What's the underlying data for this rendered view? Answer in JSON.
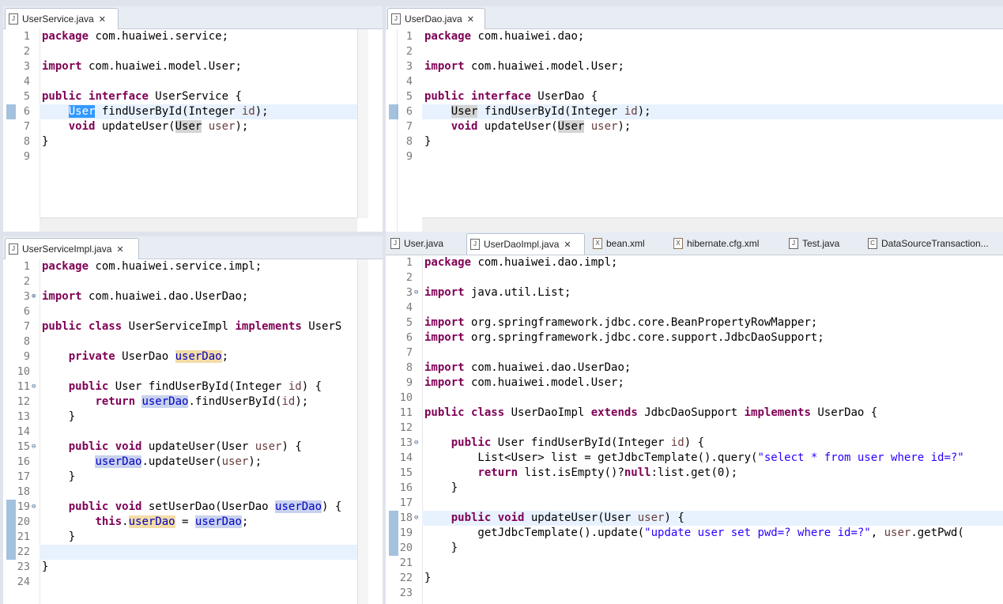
{
  "panes": {
    "top_left": {
      "tab": "UserService.java",
      "lines": [
        [
          "1",
          "package com.huaiwei.service;"
        ],
        [
          "2",
          ""
        ],
        [
          "3",
          "import com.huaiwei.model.User;"
        ],
        [
          "4",
          ""
        ],
        [
          "5",
          "public interface UserService {"
        ],
        [
          "6",
          "    User findUserById(Integer id);"
        ],
        [
          "7",
          "    void updateUser(User user);"
        ],
        [
          "8",
          "}"
        ],
        [
          "9",
          ""
        ]
      ]
    },
    "top_right": {
      "tab": "UserDao.java",
      "lines": [
        [
          "1",
          "package com.huaiwei.dao;"
        ],
        [
          "2",
          ""
        ],
        [
          "3",
          "import com.huaiwei.model.User;"
        ],
        [
          "4",
          ""
        ],
        [
          "5",
          "public interface UserDao {"
        ],
        [
          "6",
          "    User findUserById(Integer id);"
        ],
        [
          "7",
          "    void updateUser(User user);"
        ],
        [
          "8",
          "}"
        ],
        [
          "9",
          ""
        ]
      ]
    },
    "bottom_left": {
      "tab": "UserServiceImpl.java",
      "lines": [
        [
          "1",
          "package com.huaiwei.service.impl;"
        ],
        [
          "2",
          ""
        ],
        [
          "3",
          "import com.huaiwei.dao.UserDao;"
        ],
        [
          "6",
          ""
        ],
        [
          "7",
          "public class UserServiceImpl implements UserS"
        ],
        [
          "8",
          ""
        ],
        [
          "9",
          "    private UserDao userDao;"
        ],
        [
          "10",
          ""
        ],
        [
          "11",
          "    public User findUserById(Integer id) {"
        ],
        [
          "12",
          "        return userDao.findUserById(id);"
        ],
        [
          "13",
          "    }"
        ],
        [
          "14",
          ""
        ],
        [
          "15",
          "    public void updateUser(User user) {"
        ],
        [
          "16",
          "        userDao.updateUser(user);"
        ],
        [
          "17",
          "    }"
        ],
        [
          "18",
          ""
        ],
        [
          "19",
          "    public void setUserDao(UserDao userDao) {"
        ],
        [
          "20",
          "        this.userDao = userDao;"
        ],
        [
          "21",
          "    }"
        ],
        [
          "22",
          ""
        ],
        [
          "23",
          "}"
        ],
        [
          "24",
          ""
        ]
      ]
    },
    "bottom_right": {
      "tabs": [
        "User.java",
        "UserDaoImpl.java",
        "bean.xml",
        "hibernate.cfg.xml",
        "Test.java",
        "DataSourceTransaction..."
      ],
      "lines": [
        [
          "1",
          "package com.huaiwei.dao.impl;"
        ],
        [
          "2",
          ""
        ],
        [
          "3",
          "import java.util.List;"
        ],
        [
          "4",
          ""
        ],
        [
          "5",
          "import org.springframework.jdbc.core.BeanPropertyRowMapper;"
        ],
        [
          "6",
          "import org.springframework.jdbc.core.support.JdbcDaoSupport;"
        ],
        [
          "7",
          ""
        ],
        [
          "8",
          "import com.huaiwei.dao.UserDao;"
        ],
        [
          "9",
          "import com.huaiwei.model.User;"
        ],
        [
          "10",
          ""
        ],
        [
          "11",
          "public class UserDaoImpl extends JdbcDaoSupport implements UserDao {"
        ],
        [
          "12",
          ""
        ],
        [
          "13",
          "    public User findUserById(Integer id) {"
        ],
        [
          "14",
          "        List<User> list = getJdbcTemplate().query(\"select * from user where id=?\""
        ],
        [
          "15",
          "        return list.isEmpty()?null:list.get(0);"
        ],
        [
          "16",
          "    }"
        ],
        [
          "17",
          ""
        ],
        [
          "18",
          "    public void updateUser(User user) {"
        ],
        [
          "19",
          "        getJdbcTemplate().update(\"update user set pwd=? where id=?\", user.getPwd("
        ],
        [
          "20",
          "    }"
        ],
        [
          "21",
          ""
        ],
        [
          "22",
          "}"
        ],
        [
          "23",
          ""
        ]
      ]
    }
  },
  "icons": {
    "java_file": "java-file-icon",
    "xml_file": "xml-file-icon",
    "class_file": "class-file-icon",
    "close": "close-icon"
  },
  "colors": {
    "keyword": "#7f0055",
    "string": "#2a00ff",
    "field": "#0000c0",
    "param": "#6a3e3e",
    "current_line": "#e8f2fe"
  }
}
